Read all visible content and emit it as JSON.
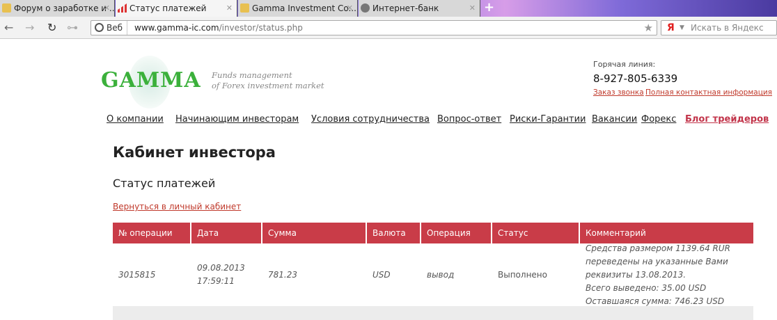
{
  "browser": {
    "tabs": [
      {
        "title": "Форум о заработке и ...",
        "active": false
      },
      {
        "title": "Статус платежей",
        "active": true
      },
      {
        "title": "Gamma Investment Co...",
        "active": false
      },
      {
        "title": "Интернет-банк",
        "active": false
      }
    ],
    "web_chip": "Веб",
    "url_host": "www.gamma-ic.com",
    "url_path": "/investor/status.php",
    "search_logo": "Я",
    "search_placeholder": "Искать в Яндекс"
  },
  "header": {
    "logo": "GAMMA",
    "tagline1": "Funds management",
    "tagline2": "of Forex investment market",
    "hotline_label": "Горячая линия:",
    "phone": "8-927-805-6339",
    "callback_link": "Заказ звонка",
    "contacts_link": "Полная контактная информация"
  },
  "nav": [
    "О компании",
    "Начинающим инвесторам",
    "Условия сотрудничества",
    "Вопрос-ответ",
    "Риски-Гарантии",
    "Вакансии",
    "Форекс",
    "Блог трейдеров"
  ],
  "page": {
    "title": "Кабинет инвестора",
    "subtitle": "Статус платежей",
    "back_link": "Вернуться в личный кабинет"
  },
  "table": {
    "headers": [
      "№ операции",
      "Дата",
      "Сумма",
      "Валюта",
      "Операция",
      "Статус",
      "Комментарий"
    ],
    "rows": [
      {
        "id": "3015815",
        "date": "09.08.2013",
        "time": "17:59:11",
        "amount": "781.23",
        "currency": "USD",
        "operation": "вывод",
        "status": "Выполнено",
        "comment": [
          "Средства размером 1139.64 RUR",
          "переведены на указанные Вами",
          "реквизиты 13.08.2013.",
          "Всего выведено: 35.00 USD",
          "Оставшаяся сумма: 746.23 USD"
        ]
      }
    ]
  },
  "colors": {
    "accent": "#c93c48",
    "logo": "#3bb03b",
    "link": "#c0392b"
  }
}
